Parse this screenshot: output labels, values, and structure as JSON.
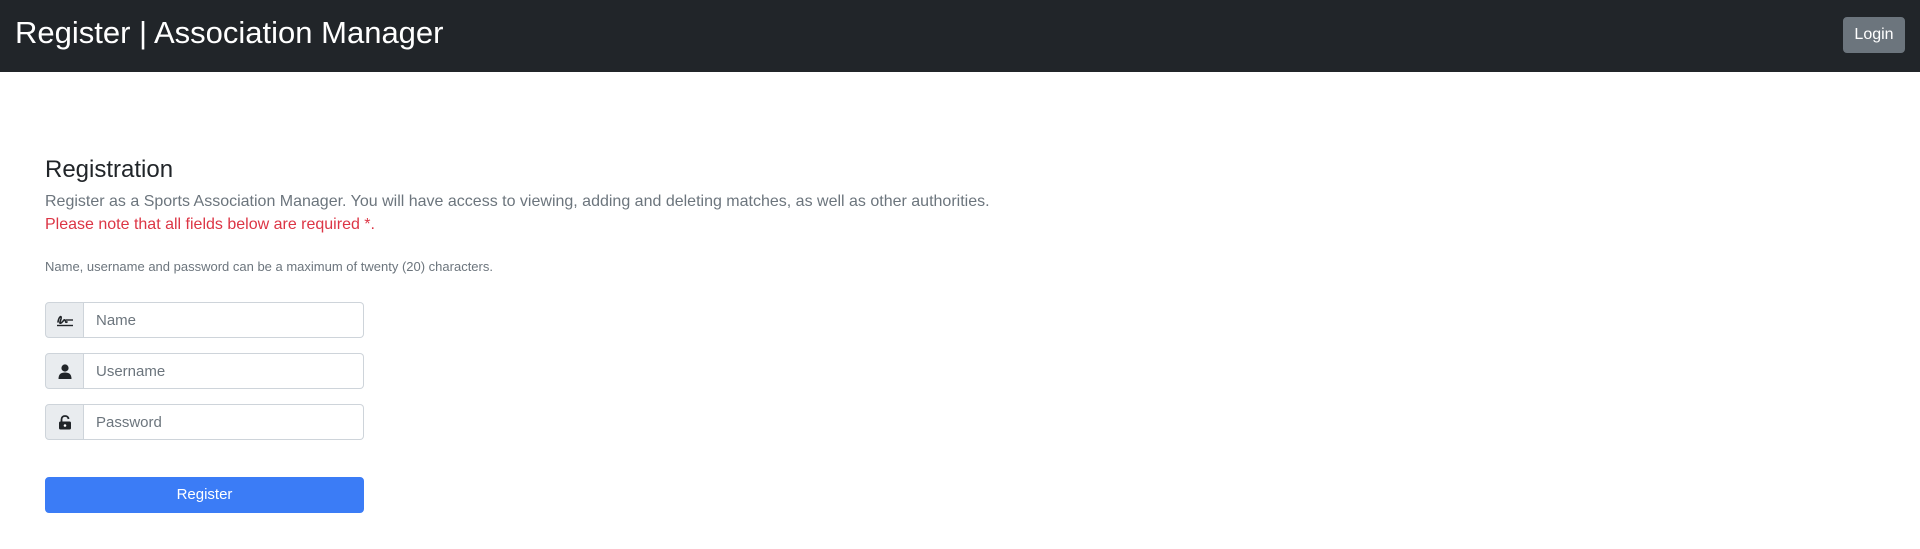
{
  "header": {
    "title": "Register | Association Manager",
    "login_label": "Login"
  },
  "registration": {
    "heading": "Registration",
    "description": "Register as a Sports Association Manager. You will have access to viewing, adding and deleting matches, as well as other authorities.",
    "required_note": "Please note that all fields below are required *.",
    "limit_note": "Name, username and password can be a maximum of twenty (20) characters."
  },
  "form": {
    "name": {
      "placeholder": "Name",
      "icon": "signature-icon",
      "value": ""
    },
    "username": {
      "placeholder": "Username",
      "icon": "user-icon",
      "value": ""
    },
    "password": {
      "placeholder": "Password",
      "icon": "unlock-icon",
      "value": ""
    },
    "submit_label": "Register"
  },
  "colors": {
    "navbar": "#212529",
    "primary": "#3b7cf6",
    "secondary": "#6c757d",
    "danger": "#dc3545"
  }
}
